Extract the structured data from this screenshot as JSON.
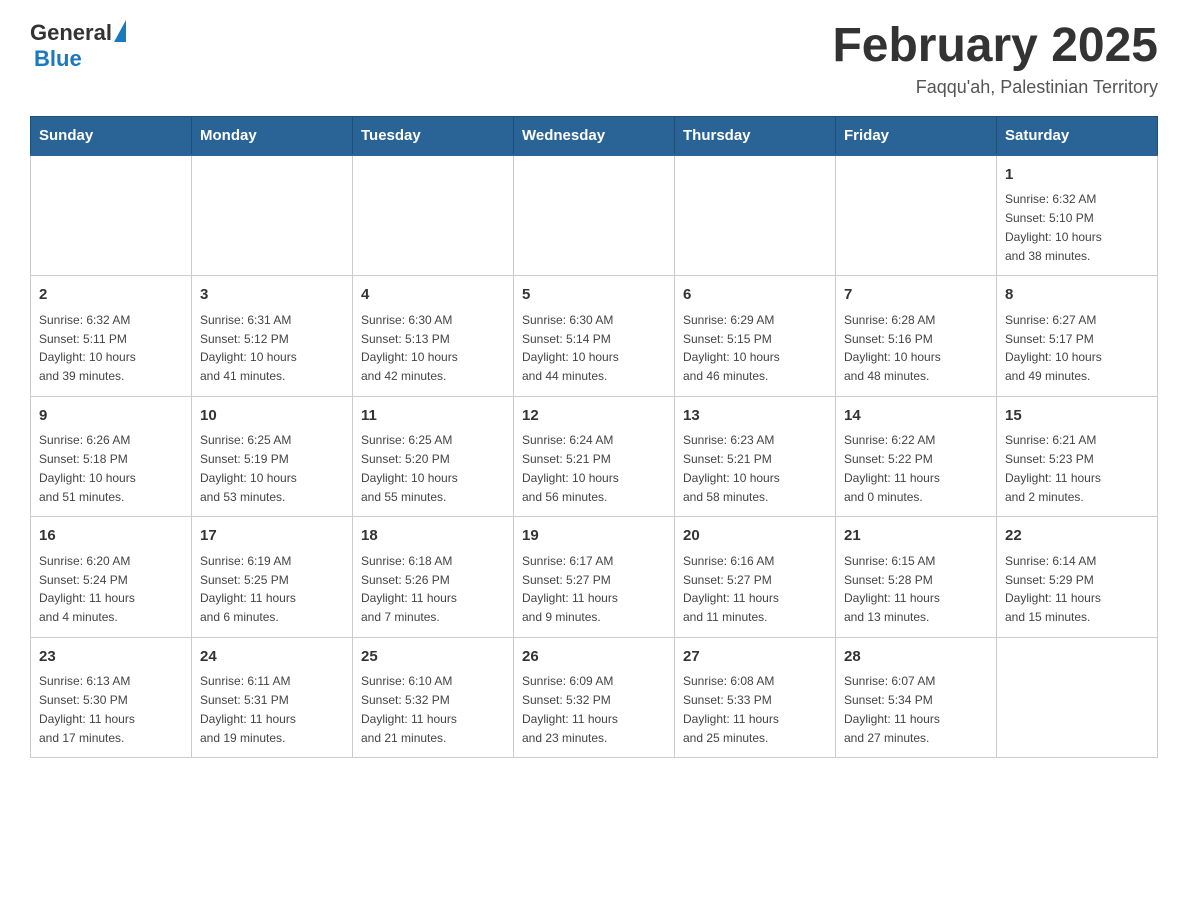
{
  "header": {
    "logo_text_general": "General",
    "logo_text_blue": "Blue",
    "title": "February 2025",
    "subtitle": "Faqqu'ah, Palestinian Territory"
  },
  "weekdays": [
    "Sunday",
    "Monday",
    "Tuesday",
    "Wednesday",
    "Thursday",
    "Friday",
    "Saturday"
  ],
  "weeks": [
    [
      {
        "day": "",
        "info": ""
      },
      {
        "day": "",
        "info": ""
      },
      {
        "day": "",
        "info": ""
      },
      {
        "day": "",
        "info": ""
      },
      {
        "day": "",
        "info": ""
      },
      {
        "day": "",
        "info": ""
      },
      {
        "day": "1",
        "info": "Sunrise: 6:32 AM\nSunset: 5:10 PM\nDaylight: 10 hours\nand 38 minutes."
      }
    ],
    [
      {
        "day": "2",
        "info": "Sunrise: 6:32 AM\nSunset: 5:11 PM\nDaylight: 10 hours\nand 39 minutes."
      },
      {
        "day": "3",
        "info": "Sunrise: 6:31 AM\nSunset: 5:12 PM\nDaylight: 10 hours\nand 41 minutes."
      },
      {
        "day": "4",
        "info": "Sunrise: 6:30 AM\nSunset: 5:13 PM\nDaylight: 10 hours\nand 42 minutes."
      },
      {
        "day": "5",
        "info": "Sunrise: 6:30 AM\nSunset: 5:14 PM\nDaylight: 10 hours\nand 44 minutes."
      },
      {
        "day": "6",
        "info": "Sunrise: 6:29 AM\nSunset: 5:15 PM\nDaylight: 10 hours\nand 46 minutes."
      },
      {
        "day": "7",
        "info": "Sunrise: 6:28 AM\nSunset: 5:16 PM\nDaylight: 10 hours\nand 48 minutes."
      },
      {
        "day": "8",
        "info": "Sunrise: 6:27 AM\nSunset: 5:17 PM\nDaylight: 10 hours\nand 49 minutes."
      }
    ],
    [
      {
        "day": "9",
        "info": "Sunrise: 6:26 AM\nSunset: 5:18 PM\nDaylight: 10 hours\nand 51 minutes."
      },
      {
        "day": "10",
        "info": "Sunrise: 6:25 AM\nSunset: 5:19 PM\nDaylight: 10 hours\nand 53 minutes."
      },
      {
        "day": "11",
        "info": "Sunrise: 6:25 AM\nSunset: 5:20 PM\nDaylight: 10 hours\nand 55 minutes."
      },
      {
        "day": "12",
        "info": "Sunrise: 6:24 AM\nSunset: 5:21 PM\nDaylight: 10 hours\nand 56 minutes."
      },
      {
        "day": "13",
        "info": "Sunrise: 6:23 AM\nSunset: 5:21 PM\nDaylight: 10 hours\nand 58 minutes."
      },
      {
        "day": "14",
        "info": "Sunrise: 6:22 AM\nSunset: 5:22 PM\nDaylight: 11 hours\nand 0 minutes."
      },
      {
        "day": "15",
        "info": "Sunrise: 6:21 AM\nSunset: 5:23 PM\nDaylight: 11 hours\nand 2 minutes."
      }
    ],
    [
      {
        "day": "16",
        "info": "Sunrise: 6:20 AM\nSunset: 5:24 PM\nDaylight: 11 hours\nand 4 minutes."
      },
      {
        "day": "17",
        "info": "Sunrise: 6:19 AM\nSunset: 5:25 PM\nDaylight: 11 hours\nand 6 minutes."
      },
      {
        "day": "18",
        "info": "Sunrise: 6:18 AM\nSunset: 5:26 PM\nDaylight: 11 hours\nand 7 minutes."
      },
      {
        "day": "19",
        "info": "Sunrise: 6:17 AM\nSunset: 5:27 PM\nDaylight: 11 hours\nand 9 minutes."
      },
      {
        "day": "20",
        "info": "Sunrise: 6:16 AM\nSunset: 5:27 PM\nDaylight: 11 hours\nand 11 minutes."
      },
      {
        "day": "21",
        "info": "Sunrise: 6:15 AM\nSunset: 5:28 PM\nDaylight: 11 hours\nand 13 minutes."
      },
      {
        "day": "22",
        "info": "Sunrise: 6:14 AM\nSunset: 5:29 PM\nDaylight: 11 hours\nand 15 minutes."
      }
    ],
    [
      {
        "day": "23",
        "info": "Sunrise: 6:13 AM\nSunset: 5:30 PM\nDaylight: 11 hours\nand 17 minutes."
      },
      {
        "day": "24",
        "info": "Sunrise: 6:11 AM\nSunset: 5:31 PM\nDaylight: 11 hours\nand 19 minutes."
      },
      {
        "day": "25",
        "info": "Sunrise: 6:10 AM\nSunset: 5:32 PM\nDaylight: 11 hours\nand 21 minutes."
      },
      {
        "day": "26",
        "info": "Sunrise: 6:09 AM\nSunset: 5:32 PM\nDaylight: 11 hours\nand 23 minutes."
      },
      {
        "day": "27",
        "info": "Sunrise: 6:08 AM\nSunset: 5:33 PM\nDaylight: 11 hours\nand 25 minutes."
      },
      {
        "day": "28",
        "info": "Sunrise: 6:07 AM\nSunset: 5:34 PM\nDaylight: 11 hours\nand 27 minutes."
      },
      {
        "day": "",
        "info": ""
      }
    ]
  ]
}
